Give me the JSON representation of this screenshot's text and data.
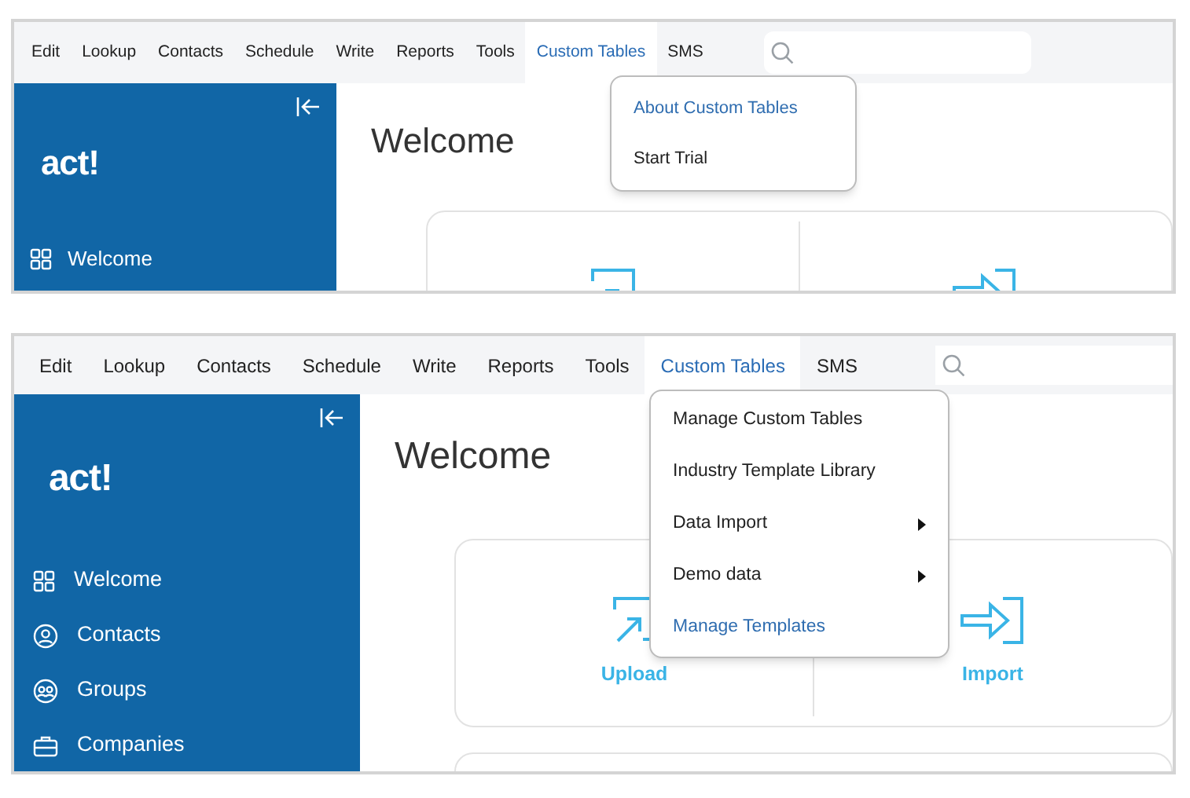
{
  "screenshots": [
    {
      "menu_bar": [
        {
          "label": "Edit",
          "selected": false
        },
        {
          "label": "Lookup",
          "selected": false
        },
        {
          "label": "Contacts",
          "selected": false
        },
        {
          "label": "Schedule",
          "selected": false
        },
        {
          "label": "Write",
          "selected": false
        },
        {
          "label": "Reports",
          "selected": false
        },
        {
          "label": "Tools",
          "selected": false
        },
        {
          "label": "Custom Tables",
          "selected": true
        },
        {
          "label": "SMS",
          "selected": false
        }
      ],
      "dropdown": [
        {
          "label": "About Custom Tables",
          "highlighted": true,
          "submenu": false
        },
        {
          "label": "Start Trial",
          "highlighted": false,
          "submenu": false
        }
      ],
      "sidebar": {
        "logo": "act!",
        "items": [
          {
            "label": "Welcome"
          }
        ]
      },
      "heading": "Welcome"
    },
    {
      "menu_bar": [
        {
          "label": "Edit",
          "selected": false
        },
        {
          "label": "Lookup",
          "selected": false
        },
        {
          "label": "Contacts",
          "selected": false
        },
        {
          "label": "Schedule",
          "selected": false
        },
        {
          "label": "Write",
          "selected": false
        },
        {
          "label": "Reports",
          "selected": false
        },
        {
          "label": "Tools",
          "selected": false
        },
        {
          "label": "Custom Tables",
          "selected": true
        },
        {
          "label": "SMS",
          "selected": false
        }
      ],
      "dropdown": [
        {
          "label": "Manage Custom Tables",
          "highlighted": false,
          "submenu": false
        },
        {
          "label": "Industry Template Library",
          "highlighted": false,
          "submenu": false
        },
        {
          "label": "Data Import",
          "highlighted": false,
          "submenu": true
        },
        {
          "label": "Demo data",
          "highlighted": false,
          "submenu": true
        },
        {
          "label": "Manage Templates",
          "highlighted": true,
          "submenu": false
        }
      ],
      "sidebar": {
        "logo": "act!",
        "items": [
          {
            "label": "Welcome"
          },
          {
            "label": "Contacts"
          },
          {
            "label": "Groups"
          },
          {
            "label": "Companies"
          }
        ]
      },
      "heading": "Welcome",
      "card": {
        "actions": [
          {
            "label": "Upload"
          },
          {
            "label": "Import"
          }
        ]
      }
    }
  ]
}
